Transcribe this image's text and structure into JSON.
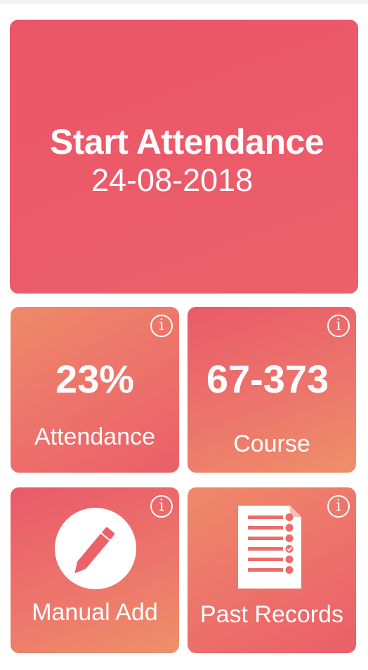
{
  "main": {
    "title": "Start Attendance",
    "date": "24-08-2018"
  },
  "tiles": {
    "attendance": {
      "value": "23%",
      "label": "Attendance",
      "info_glyph": "i"
    },
    "course": {
      "value": "67-373",
      "label": "Course",
      "info_glyph": "i"
    },
    "manual_add": {
      "label": "Manual Add",
      "icon": "pencil-icon",
      "info_glyph": "i"
    },
    "past_records": {
      "label": "Past Records",
      "icon": "checklist-document-icon",
      "info_glyph": "i"
    }
  },
  "colors": {
    "primary": "#ec5569",
    "secondary": "#ef8a6a",
    "text": "#ffffff"
  }
}
